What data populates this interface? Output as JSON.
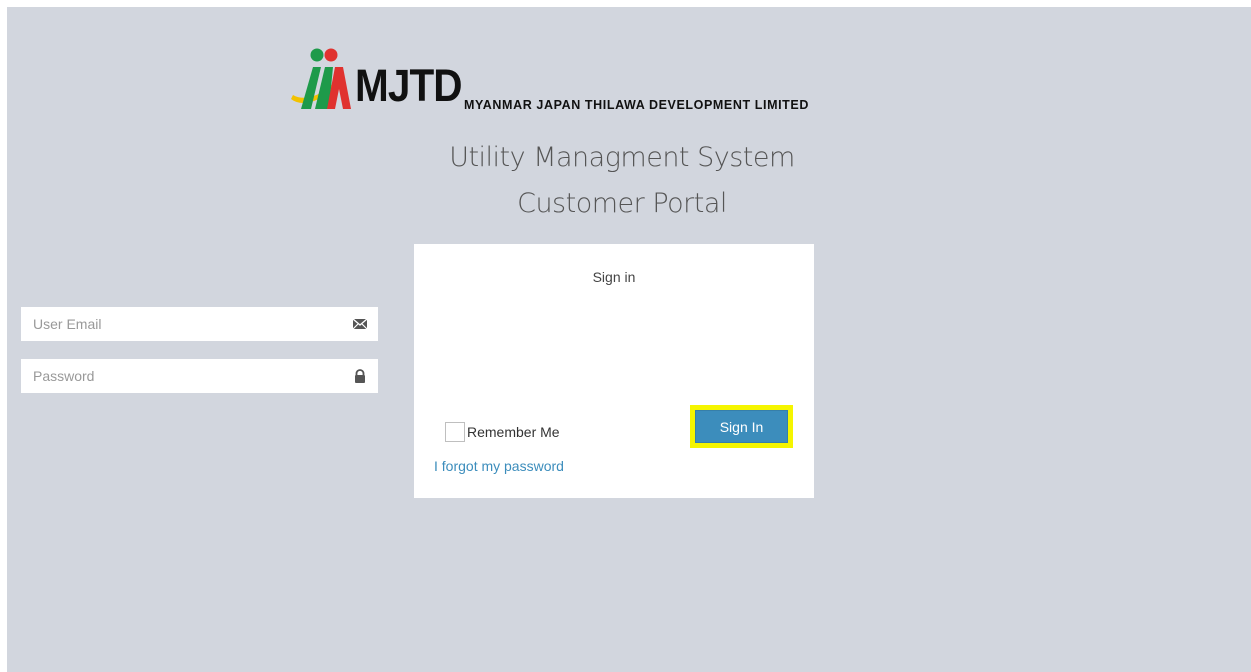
{
  "logo": {
    "wordmark": "MJTD",
    "company_name": "MYANMAR JAPAN THILAWA DEVELOPMENT LIMITED"
  },
  "header": {
    "title_line1": "Utility Managment System",
    "title_line2": "Customer Portal"
  },
  "login": {
    "box_title": "Sign in",
    "email_placeholder": "User Email",
    "email_value": "",
    "password_placeholder": "Password",
    "password_value": "",
    "remember_label": "Remember Me",
    "remember_checked": false,
    "signin_label": "Sign In",
    "forgot_label": "I forgot my password"
  },
  "icons": {
    "email": "envelope-icon",
    "password": "lock-icon"
  },
  "colors": {
    "background": "#d2d6de",
    "primary": "#3c8dbc",
    "highlight": "#f5f500",
    "logo_green": "#1e9a4a",
    "logo_red": "#e0322f",
    "logo_yellow": "#f2c200"
  }
}
